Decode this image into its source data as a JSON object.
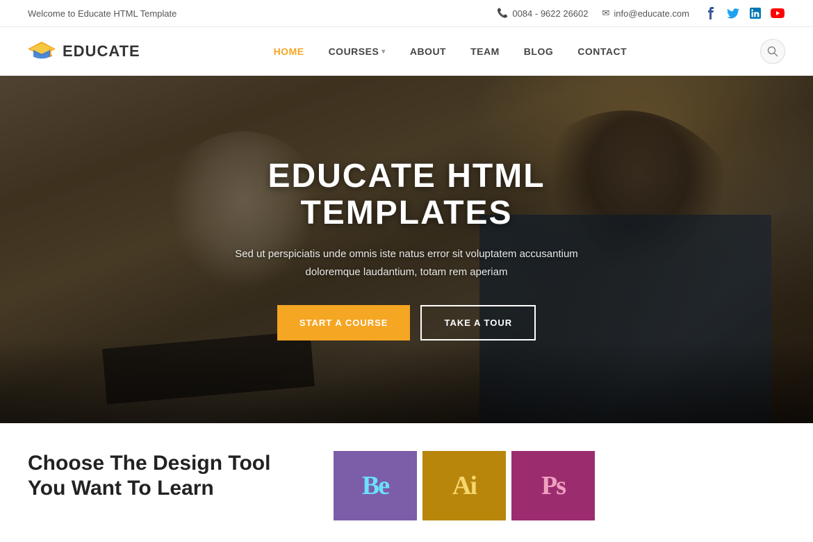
{
  "topbar": {
    "welcome_text": "Welcome to Educate HTML Template",
    "phone": "0084 - 9622 26602",
    "email": "info@educate.com"
  },
  "logo": {
    "text": "EDUCATE"
  },
  "nav": {
    "items": [
      {
        "label": "HOME",
        "active": true,
        "has_dropdown": false
      },
      {
        "label": "COURSES",
        "active": false,
        "has_dropdown": true
      },
      {
        "label": "ABOUT",
        "active": false,
        "has_dropdown": false
      },
      {
        "label": "TEAM",
        "active": false,
        "has_dropdown": false
      },
      {
        "label": "BLOG",
        "active": false,
        "has_dropdown": false
      },
      {
        "label": "CONTACT",
        "active": false,
        "has_dropdown": false
      }
    ]
  },
  "hero": {
    "title": "EDUCATE HTML TEMPLATES",
    "subtitle": "Sed ut perspiciatis unde omnis iste natus error sit voluptatem accusantium\ndoloremque laudantium, totam rem aperiam",
    "btn_primary": "START A COURSE",
    "btn_secondary": "TAKE A TOUR"
  },
  "bottom": {
    "title": "Choose The Design Tool You Want To Learn",
    "tools": [
      {
        "letter": "Be",
        "bg": "#7b5ea7",
        "text_color": "#6be0ff"
      },
      {
        "letter": "Ai",
        "bg": "#b8860b",
        "text_color": "#f5d76e"
      },
      {
        "letter": "Ps",
        "bg": "#9b2d6e",
        "text_color": "#f0a0c0"
      }
    ]
  },
  "social": {
    "facebook": "f",
    "twitter": "t",
    "linkedin": "in",
    "youtube": "▶"
  },
  "icons": {
    "phone": "📞",
    "email": "✉",
    "search": "🔍",
    "chevron": "▾"
  }
}
